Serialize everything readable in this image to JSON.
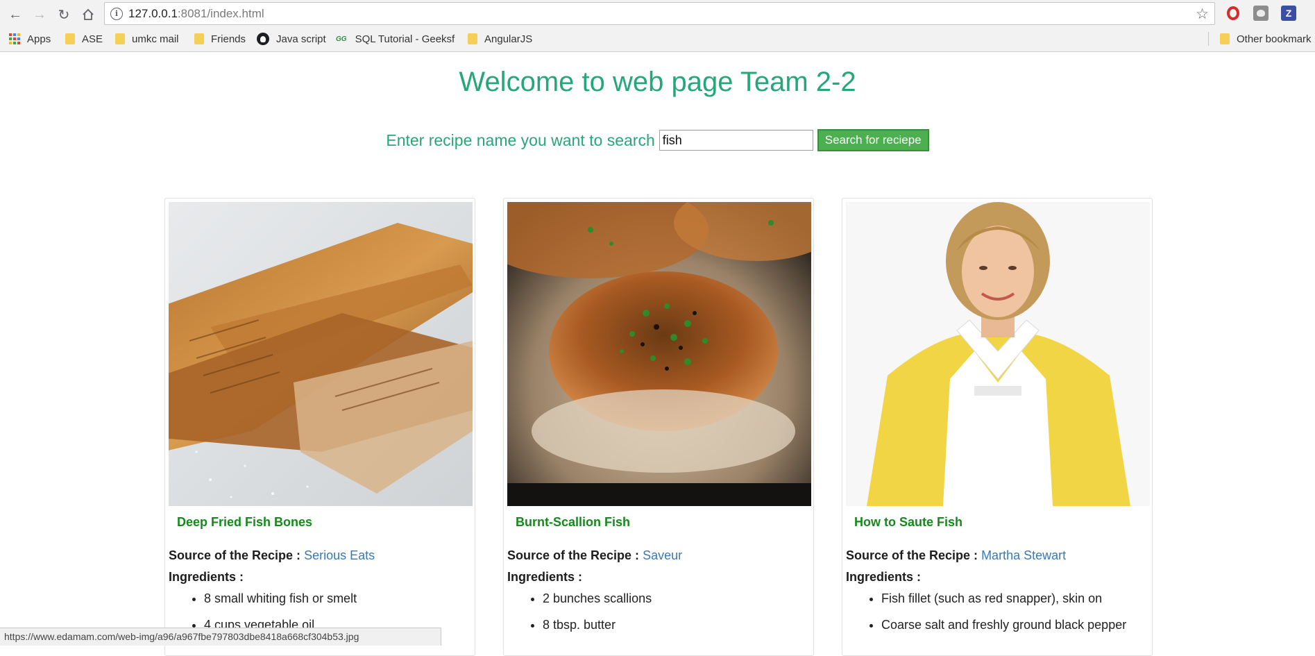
{
  "browser": {
    "url_host": "127.0.0.1",
    "url_rest": ":8081/index.html",
    "bookmarks": [
      {
        "label": "Apps",
        "icon": "apps-grid-icon"
      },
      {
        "label": "ASE",
        "icon": "folder-icon"
      },
      {
        "label": "umkc mail",
        "icon": "folder-icon"
      },
      {
        "label": "Friends",
        "icon": "folder-icon"
      },
      {
        "label": "Java script",
        "icon": "github-icon"
      },
      {
        "label": "SQL Tutorial - Geeksf",
        "icon": "geeksforgeeks-icon"
      },
      {
        "label": "AngularJS",
        "icon": "folder-icon"
      }
    ],
    "other_bookmarks": "Other bookmark",
    "extensions": {
      "z_label": "Z"
    },
    "status_url": "https://www.edamam.com/web-img/a96/a967fbe797803dbe8418a668cf304b53.jpg"
  },
  "page": {
    "title": "Welcome to web page Team 2-2",
    "search": {
      "label": "Enter recipe name you want to search",
      "value": "fish",
      "button": "Search for reciepe"
    },
    "source_label": "Source of the Recipe :",
    "ingredients_label": "Ingredients :",
    "recipes": [
      {
        "title": "Deep Fried Fish Bones",
        "source": "Serious Eats",
        "ingredients": [
          "8 small whiting fish or smelt",
          "4 cups vegetable oil"
        ]
      },
      {
        "title": "Burnt-Scallion Fish",
        "source": "Saveur",
        "ingredients": [
          "2 bunches scallions",
          "8 tbsp. butter"
        ]
      },
      {
        "title": "How to Saute Fish",
        "source": "Martha Stewart",
        "ingredients": [
          "Fish fillet (such as red snapper), skin on",
          "Coarse salt and freshly ground black pepper"
        ]
      }
    ]
  },
  "colors": {
    "accent_green": "#26a779",
    "button_green": "#4caf50",
    "title_green": "#138a1a",
    "link_blue": "#3a78b5"
  }
}
